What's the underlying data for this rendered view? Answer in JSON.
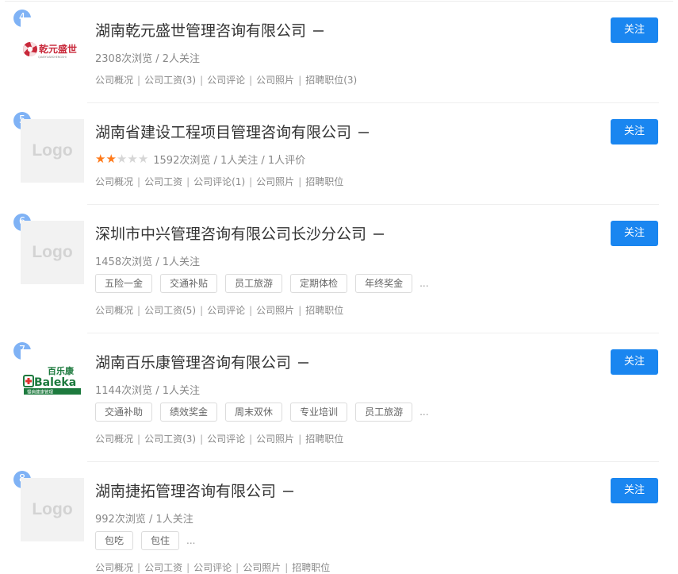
{
  "companies": [
    {
      "rank": "4",
      "name": "湖南乾元盛世管理咨询有限公司",
      "stats": "2308次浏览 / 2人关注",
      "logo_type": "brand-qianyuan",
      "logo_text": "乾元盛世",
      "logo_subtext": "QIANYUANSHENGSHI",
      "links": [
        "公司概况",
        "公司工资(3)",
        "公司评论",
        "公司照片",
        "招聘职位(3)"
      ],
      "follow_label": "关注"
    },
    {
      "rank": "5",
      "name": "湖南省建设工程项目管理咨询有限公司",
      "rating_stars": 2,
      "rating_max": 5,
      "stats": "1592次浏览 / 1人关注 / 1人评价",
      "logo_type": "placeholder",
      "logo_text": "Logo",
      "links": [
        "公司概况",
        "公司工资",
        "公司评论(1)",
        "公司照片",
        "招聘职位"
      ],
      "follow_label": "关注"
    },
    {
      "rank": "6",
      "name": "深圳市中兴管理咨询有限公司长沙分公司",
      "stats": "1458次浏览 / 1人关注",
      "logo_type": "placeholder",
      "logo_text": "Logo",
      "tags": [
        "五险一金",
        "交通补贴",
        "员工旅游",
        "定期体检",
        "年终奖金"
      ],
      "more": "...",
      "links": [
        "公司概况",
        "公司工资(5)",
        "公司评论",
        "公司照片",
        "招聘职位"
      ],
      "follow_label": "关注"
    },
    {
      "rank": "7",
      "name": "湖南百乐康管理咨询有限公司",
      "stats": "1144次浏览 / 1人关注",
      "logo_type": "brand-bailekang",
      "logo_text": "百乐康",
      "logo_subtext": "Baleka",
      "logo_slogan": "慢病健康管理",
      "tags": [
        "交通补助",
        "绩效奖金",
        "周末双休",
        "专业培训",
        "员工旅游"
      ],
      "more": "...",
      "links": [
        "公司概况",
        "公司工资(3)",
        "公司评论",
        "公司照片",
        "招聘职位"
      ],
      "follow_label": "关注"
    },
    {
      "rank": "8",
      "name": "湖南捷拓管理咨询有限公司",
      "stats": "992次浏览 / 1人关注",
      "logo_type": "placeholder",
      "logo_text": "Logo",
      "tags": [
        "包吃",
        "包住"
      ],
      "more": "...",
      "links": [
        "公司概况",
        "公司工资",
        "公司评论",
        "公司照片",
        "招聘职位"
      ],
      "follow_label": "关注"
    }
  ],
  "colors": {
    "accent": "#1a86f0",
    "badge": "#7fb2f5",
    "star_on": "#ff7a1a",
    "star_off": "#d6d6d6"
  }
}
